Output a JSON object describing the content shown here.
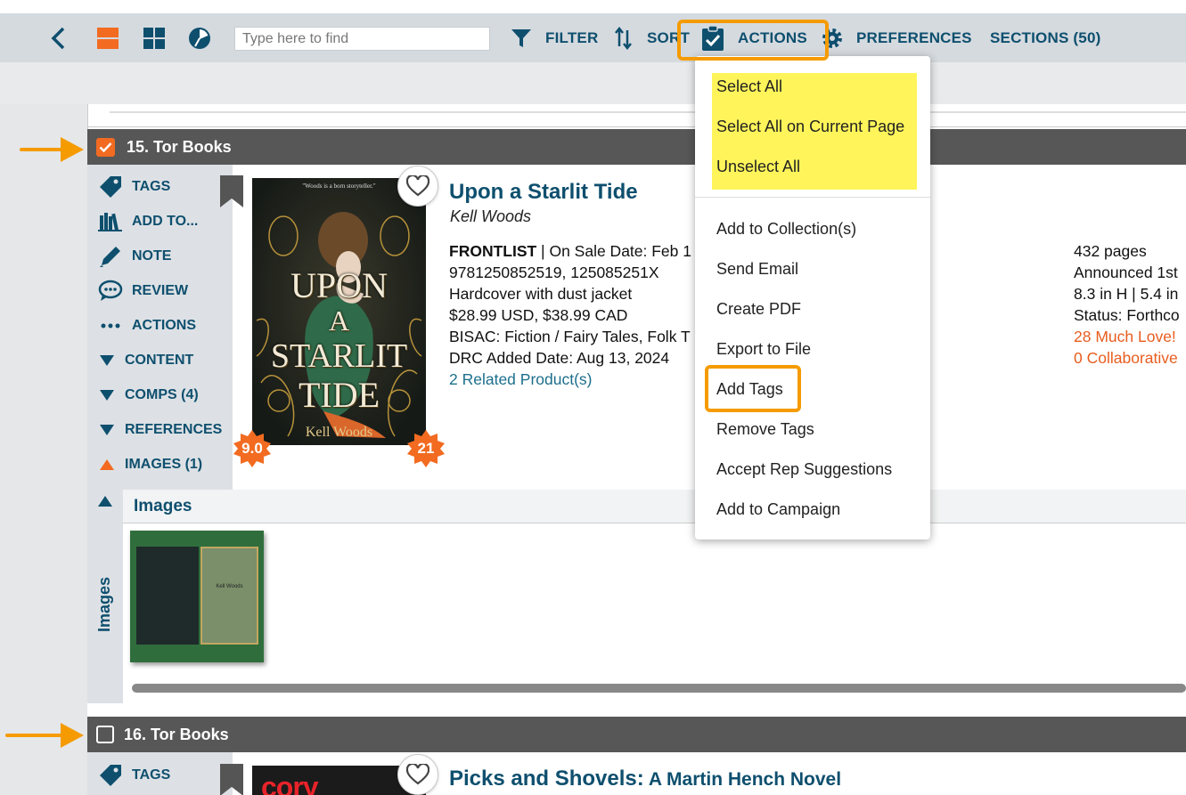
{
  "toolbar": {
    "search_placeholder": "Type here to find",
    "filter": "FILTER",
    "sort": "SORT",
    "actions": "ACTIONS",
    "preferences": "PREFERENCES",
    "sections": "SECTIONS (50)"
  },
  "colors": {
    "accent": "#f26b21",
    "brand_text": "#0e4f6e",
    "highlight": "#fff55a",
    "callout": "#f59b00"
  },
  "section15": {
    "title": "15. Tor Books",
    "checked": true,
    "actions": [
      "TAGS",
      "ADD TO...",
      "NOTE",
      "REVIEW",
      "ACTIONS",
      "CONTENT",
      "COMPS (4)",
      "REFERENCES",
      "IMAGES (1)"
    ],
    "book": {
      "cover_quote": "\"Woods is a born storyteller.\"",
      "cover_title": [
        "UPON",
        "A",
        "STARLIT",
        "TIDE"
      ],
      "cover_author": "Kell Woods",
      "title": "Upon a Starlit Tide",
      "author": "Kell Woods",
      "frontlist": "FRONTLIST",
      "sale_date": " | On Sale Date: Feb 1",
      "isbn": "9781250852519, 125085251X",
      "format": "Hardcover with dust jacket",
      "price": "$28.99 USD, $38.99 CAD",
      "bisac": "BISAC: Fiction / Fairy Tales, Folk T",
      "drc": "DRC Added Date: Aug 13, 2024",
      "related": "2 Related Product(s)",
      "pages": "432 pages",
      "announced": "Announced 1st",
      "dimensions": "8.3 in H | 5.4 in",
      "status": "Status: Forthco",
      "love": "28 Much Love!",
      "collab": "0 Collaborative",
      "badge_left": "9.0",
      "badge_right": "21"
    },
    "images_header": "Images",
    "images_side": "Images",
    "thumb_text": "Kell Woods"
  },
  "section16": {
    "title": "16. Tor Books",
    "checked": false,
    "first_action": "TAGS",
    "book_title": "Picks and Shovels:",
    "book_subtitle": " A Martin Hench Novel",
    "cover_text": "cory"
  },
  "dropdown": {
    "select_group": [
      "Select All",
      "Select All on Current Page",
      "Unselect All"
    ],
    "items": [
      "Add to Collection(s)",
      "Send Email",
      "Create PDF",
      "Export to File",
      "Add Tags",
      "Remove Tags",
      "Accept Rep Suggestions",
      "Add to Campaign"
    ]
  }
}
